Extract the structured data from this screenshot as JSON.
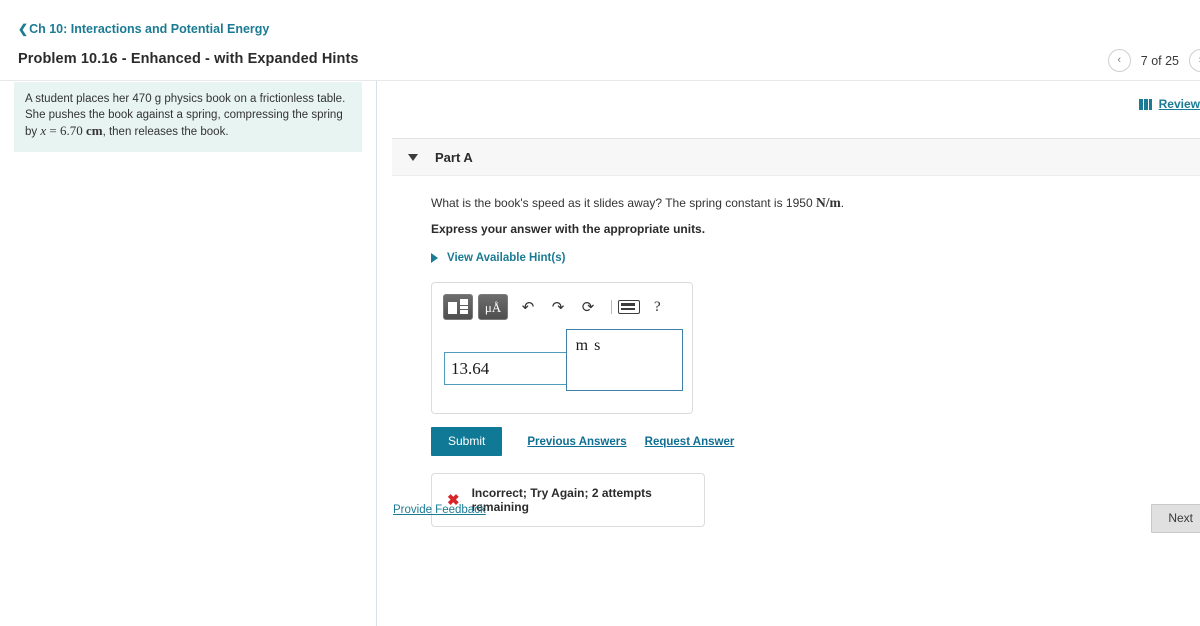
{
  "header": {
    "back_chevron": "chevron-left-icon",
    "breadcrumb": "Ch 10: Interactions and Potential Energy",
    "problem_title": "Problem 10.16 - Enhanced - with Expanded Hints",
    "pager": {
      "prev_label": "‹",
      "next_label": "›",
      "count": "7 of 25"
    }
  },
  "review": {
    "icon": "books-icon",
    "label": "Review"
  },
  "problem_statement": {
    "text_before_var": "A student places her 470 g physics book on a frictionless table. She pushes the book against a spring, compressing the spring by ",
    "variable": "x",
    "equals_value": " = 6.70 ",
    "unit": "cm",
    "text_after": ", then releases the book."
  },
  "part": {
    "toggle_icon": "triangle-down-icon",
    "label": "Part A",
    "question_text": "What is the book's speed as it slides away? The spring constant is 1950 ",
    "question_unit": "N/m",
    "question_period": ".",
    "express_instruction": "Express your answer with the appropriate units.",
    "hints": {
      "icon": "triangle-right-icon",
      "label": "View Available Hint(s)"
    }
  },
  "answer": {
    "toolbar": {
      "template_button": "math-template-icon",
      "units_button": "μÅ",
      "undo": "↶",
      "redo": "↷",
      "reset": "⟳",
      "keyboard": "keyboard-icon",
      "help": "?"
    },
    "value": "13.64",
    "unit_numerator": "m",
    "unit_denominator": "s"
  },
  "actions": {
    "submit_label": "Submit",
    "previous_answers_label": "Previous Answers",
    "request_answer_label": "Request Answer"
  },
  "feedback": {
    "icon": "✖",
    "message": "Incorrect; Try Again; 2 attempts remaining"
  },
  "footer": {
    "provide_feedback_label": "Provide Feedback",
    "next_label": "Next"
  },
  "colors": {
    "accent_teal": "#1b7b94",
    "submit_teal": "#107a96",
    "statement_bg": "#e8f4f2",
    "error_red": "#d9252a",
    "field_border": "#4e9cb8"
  }
}
